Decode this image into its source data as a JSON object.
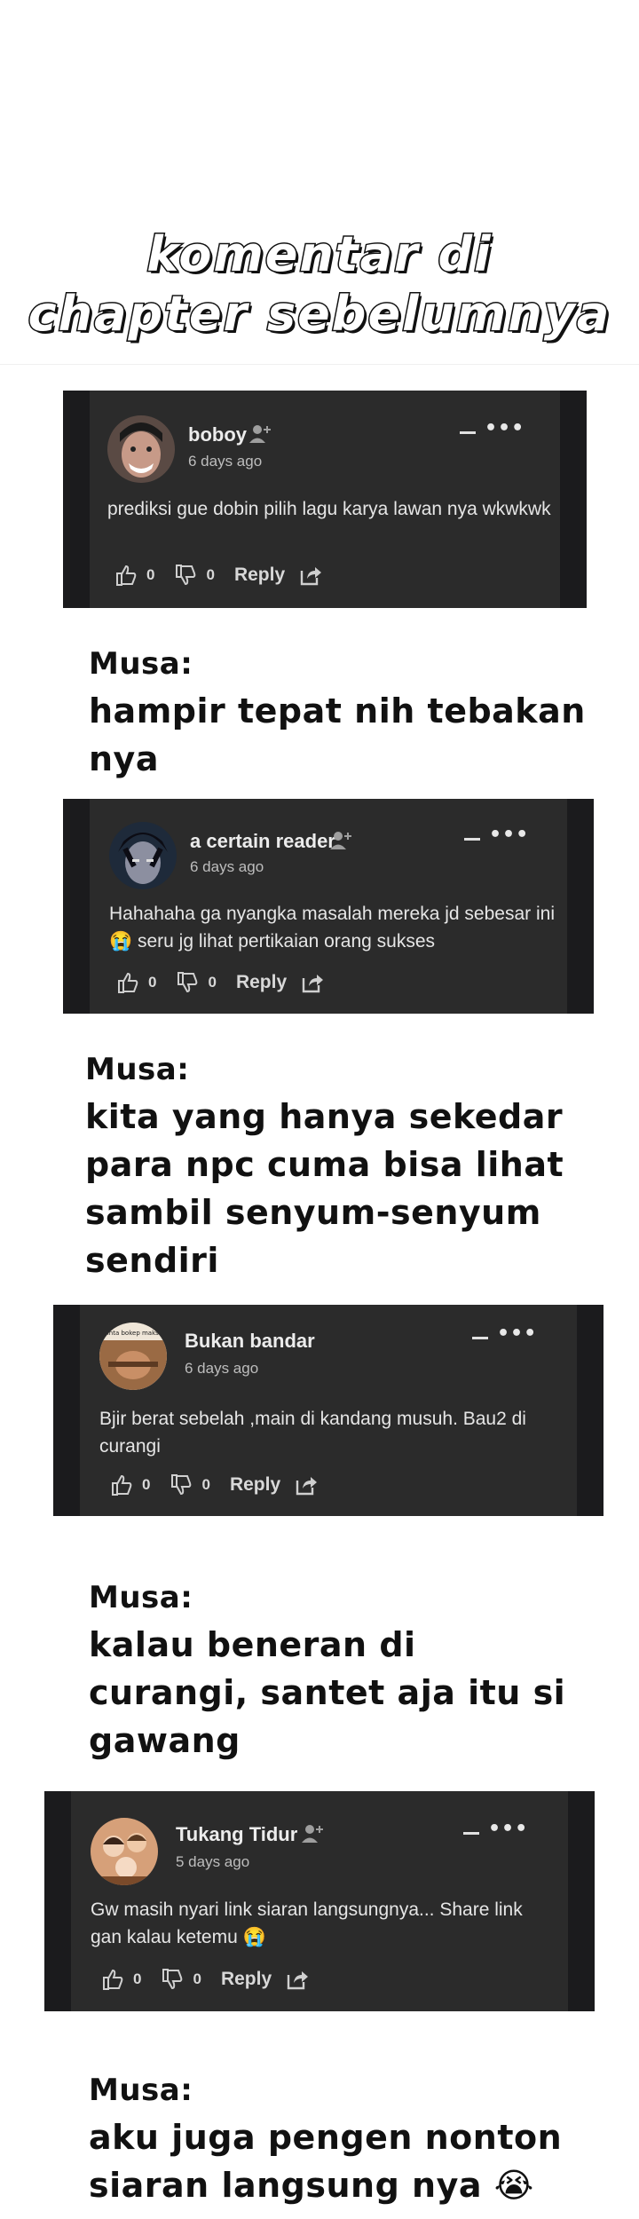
{
  "header": {
    "title_line1": "komentar di",
    "title_line2": "chapter sebelumnya"
  },
  "comments": [
    {
      "username": "boboy",
      "time": "6 days ago",
      "text": "prediksi gue dobin pilih lagu karya lawan nya wkwkwk",
      "likes": "0",
      "dislikes": "0",
      "reply_label": "Reply",
      "avatar_icon": "man-face-avatar",
      "has_follow": true
    },
    {
      "username": "a certain reader",
      "time": "6 days ago",
      "text": "Hahahaha ga nyangka masalah mereka jd sebesar ini😭 seru jg lihat pertikaian orang sukses",
      "likes": "0",
      "dislikes": "0",
      "reply_label": "Reply",
      "avatar_icon": "dark-hair-avatar",
      "has_follow": true
    },
    {
      "username": "Bukan bandar",
      "time": "6 days ago",
      "text": "Bjir berat sebelah ,main di kandang musuh. Bau2 di curangi",
      "likes": "0",
      "dislikes": "0",
      "reply_label": "Reply",
      "avatar_icon": "meme-avatar",
      "avatar_caption": "Minta bokep maksih",
      "has_follow": false
    },
    {
      "username": "Tukang Tidur",
      "time": "5 days ago",
      "text": "Gw masih nyari link siaran langsungnya... Share link gan kalau ketemu 😭",
      "likes": "0",
      "dislikes": "0",
      "reply_label": "Reply",
      "avatar_icon": "group-photo-avatar",
      "has_follow": true
    }
  ],
  "responses": [
    {
      "speaker": "Musa:",
      "text": "hampir tepat nih tebakan nya"
    },
    {
      "speaker": "Musa:",
      "text": "kita yang hanya sekedar para npc cuma bisa lihat sambil senyum-senyum sendiri"
    },
    {
      "speaker": "Musa:",
      "text": "kalau beneran di curangi, santet aja itu si gawang"
    },
    {
      "speaker": "Musa:",
      "text": "aku juga pengen nonton siaran langsung nya 😭"
    }
  ],
  "colors": {
    "card_outer": "#1b1b1d",
    "card_inner": "#2b2b2b",
    "text_light": "#e6e6e6"
  }
}
